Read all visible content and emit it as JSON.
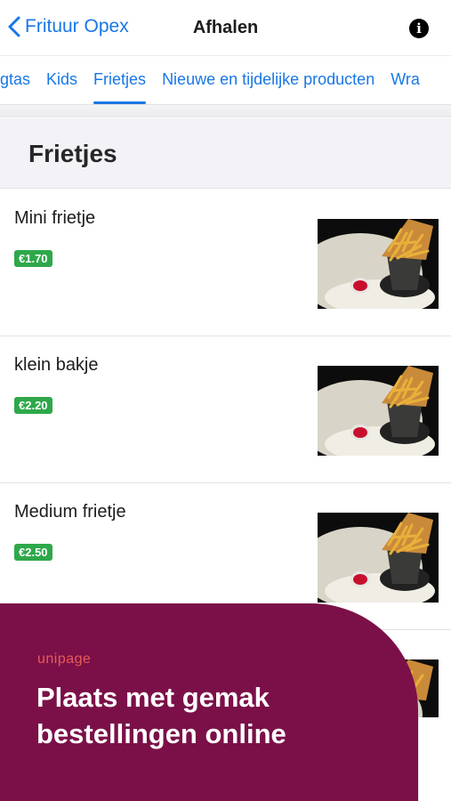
{
  "navbar": {
    "back_label": "Frituur Opex",
    "title": "Afhalen",
    "info_icon": "info-icon"
  },
  "tabs": [
    {
      "label": "gtas",
      "active": false
    },
    {
      "label": "Kids",
      "active": false
    },
    {
      "label": "Frietjes",
      "active": true
    },
    {
      "label": "Nieuwe en tijdelijke producten",
      "active": false
    },
    {
      "label": "Wra",
      "active": false
    }
  ],
  "section": {
    "title": "Frietjes"
  },
  "products": [
    {
      "name": "Mini frietje",
      "price": "€1.70"
    },
    {
      "name": "klein bakje",
      "price": "€2.20"
    },
    {
      "name": "Medium frietje",
      "price": "€2.50"
    },
    {
      "name": "",
      "price": ""
    }
  ],
  "banner": {
    "logo": "unipage",
    "headline_line1": "Plaats met gemak",
    "headline_line2": "bestellingen online"
  },
  "colors": {
    "accent": "#1877e6",
    "price_badge": "#2ea84a",
    "banner": "#7b1048",
    "logo": "#e85a5a"
  }
}
